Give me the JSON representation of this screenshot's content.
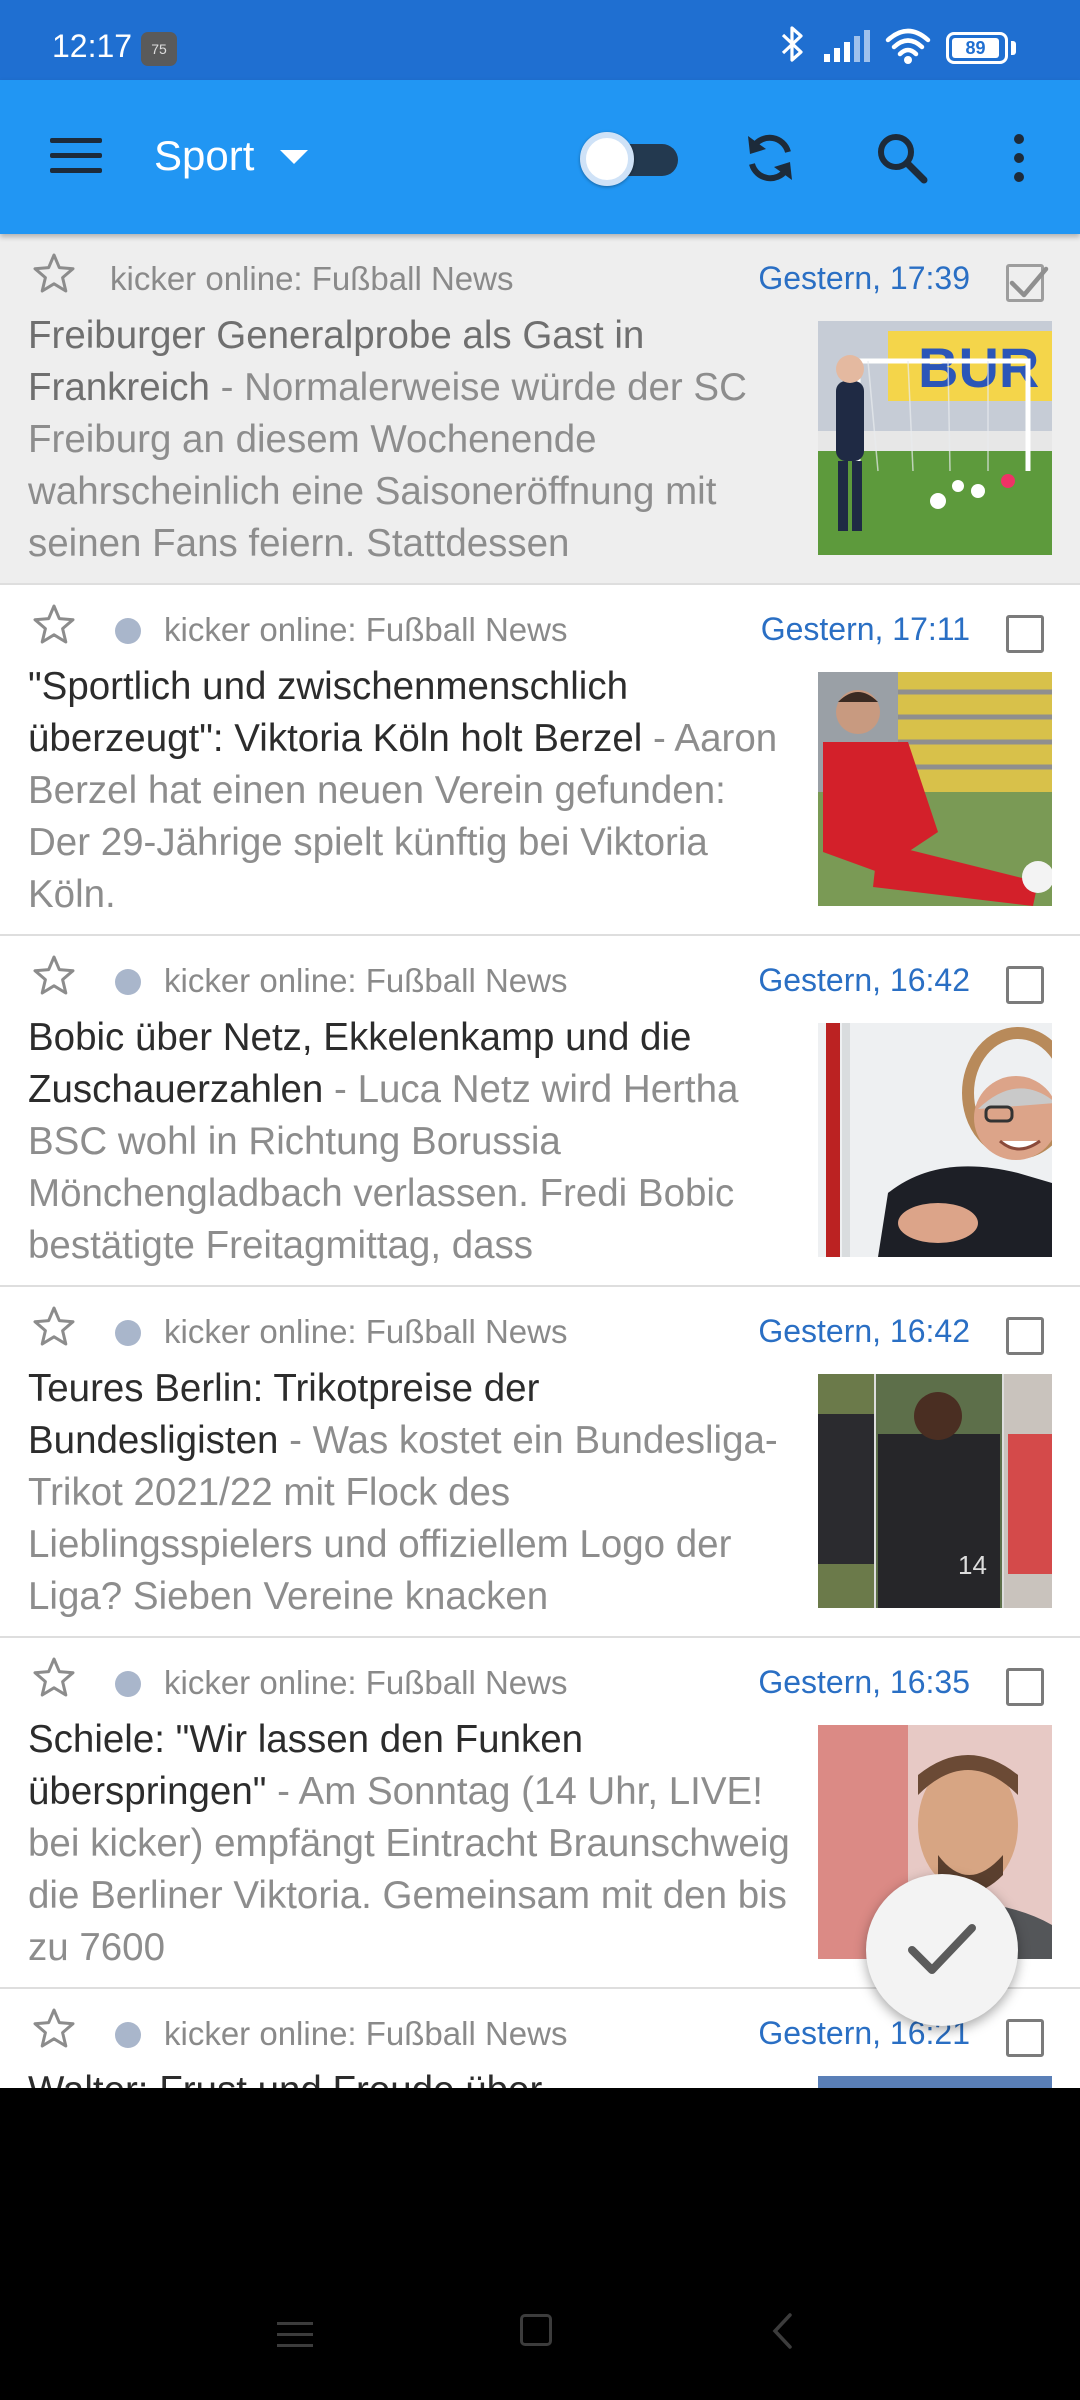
{
  "status_bar": {
    "time": "12:17",
    "notification_badge": "75",
    "battery": "89",
    "icons": [
      "bluetooth-icon",
      "signal-icon",
      "wifi-icon",
      "battery-icon"
    ]
  },
  "toolbar": {
    "title": "Sport",
    "icons": [
      "menu-icon",
      "dropdown-caret-icon",
      "toggle-switch",
      "refresh-icon",
      "search-icon",
      "more-vert-icon"
    ],
    "toggle_on": false
  },
  "articles": [
    {
      "source": "kicker online: Fußball News",
      "date": "Gestern, 17:39",
      "title": "Freiburger Generalprobe als Gast in Frankreich",
      "snippet": " - Normalerweise würde der SC Freiburg an diesem Wochenende wahrscheinlich eine Saisoneröffnung mit seinen Fans feiern. Stattdessen",
      "read": true,
      "checked": true,
      "unread_dot": false
    },
    {
      "source": "kicker online: Fußball News",
      "date": "Gestern, 17:11",
      "title": "\"Sportlich und zwischenmenschlich überzeugt\": Viktoria Köln holt Berzel",
      "snippet": " - Aaron Berzel hat einen neuen Verein gefunden: Der 29-Jährige spielt künftig bei Viktoria Köln.",
      "read": false,
      "checked": false,
      "unread_dot": true
    },
    {
      "source": "kicker online: Fußball News",
      "date": "Gestern, 16:42",
      "title": "Bobic über Netz, Ekkelenkamp und die Zuschauerzahlen",
      "snippet": " - Luca Netz wird Hertha BSC wohl in Richtung Borussia Mönchengladbach verlassen. Fredi Bobic bestätigte Freitagmittag, dass",
      "read": false,
      "checked": false,
      "unread_dot": true
    },
    {
      "source": "kicker online: Fußball News",
      "date": "Gestern, 16:42",
      "title": "Teures Berlin: Trikotpreise der Bundesligisten",
      "snippet": " - Was kostet ein Bundesliga-Trikot 2021/22 mit Flock des Lieblingsspielers und offiziellem Logo der Liga? Sieben Vereine knacken",
      "read": false,
      "checked": false,
      "unread_dot": true
    },
    {
      "source": "kicker online: Fußball News",
      "date": "Gestern, 16:35",
      "title": "Schiele: \"Wir lassen den Funken überspringen\"",
      "snippet": " - Am Sonntag (14 Uhr, LIVE! bei kicker) empfängt Eintracht Braunschweig die Berliner Viktoria. Gemeinsam mit den bis zu 7600",
      "read": false,
      "checked": false,
      "unread_dot": true
    },
    {
      "source": "kicker online: Fußball News",
      "date": "Gestern, 16:21",
      "title": "Walter: Frust und Freude über",
      "snippet": "",
      "read": false,
      "checked": false,
      "unread_dot": true
    }
  ],
  "fab": {
    "icon": "check-icon"
  },
  "nav_bar": {
    "icons": [
      "recents-icon",
      "home-icon",
      "back-icon"
    ]
  },
  "colors": {
    "status_bar": "#1f6fd1",
    "toolbar": "#2196f3",
    "date_text": "#2a6fc4",
    "unread_dot": "#a9b6cb"
  }
}
